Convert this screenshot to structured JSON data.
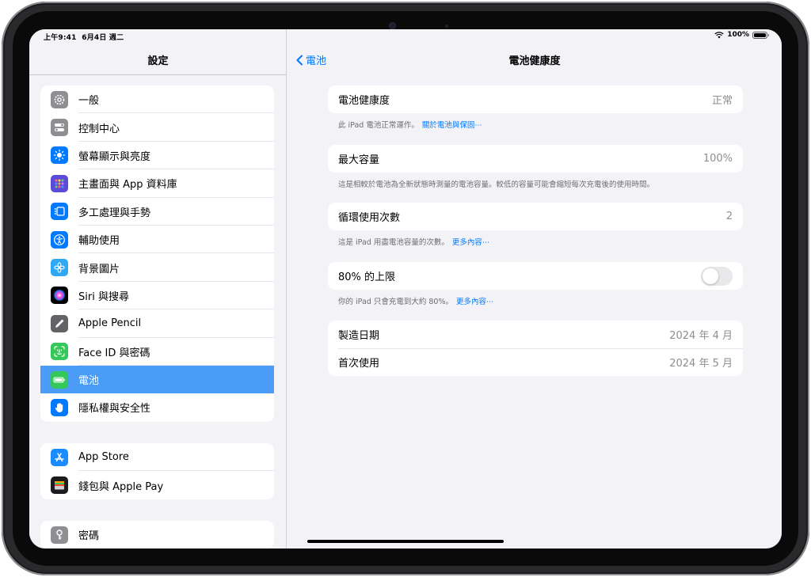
{
  "status_bar": {
    "time": "上午9:41",
    "date": "6月4日 週二",
    "battery": "100%"
  },
  "sidebar": {
    "title": "設定",
    "groups": [
      {
        "items": [
          {
            "label": "一般"
          },
          {
            "label": "控制中心"
          },
          {
            "label": "螢幕顯示與亮度"
          },
          {
            "label": "主畫面與 App 資料庫"
          },
          {
            "label": "多工處理與手勢"
          },
          {
            "label": "輔助使用"
          },
          {
            "label": "背景圖片"
          },
          {
            "label": "Siri 與搜尋"
          },
          {
            "label": "Apple Pencil"
          },
          {
            "label": "Face ID 與密碼"
          },
          {
            "label": "電池",
            "selected": true
          },
          {
            "label": "隱私權與安全性"
          }
        ]
      },
      {
        "items": [
          {
            "label": "App Store"
          },
          {
            "label": "錢包與 Apple Pay"
          }
        ]
      },
      {
        "items": [
          {
            "label": "密碼"
          }
        ]
      }
    ]
  },
  "detail": {
    "back_label": "電池",
    "title": "電池健康度",
    "battery_health": {
      "label": "電池健康度",
      "value": "正常",
      "note": "此 iPad 電池正常運作。",
      "link": "關於電池與保固⋯"
    },
    "max_capacity": {
      "label": "最大容量",
      "value": "100%",
      "note": "這是相較於電池為全新狀態時測量的電池容量。較低的容量可能會縮短每次充電後的使用時間。"
    },
    "cycle_count": {
      "label": "循環使用次數",
      "value": "2",
      "note": "這是 iPad 用盡電池容量的次數。",
      "link": "更多內容⋯"
    },
    "limit_80": {
      "label": "80% 的上限",
      "enabled": false,
      "note": "你的 iPad 只會充電到大約 80%。",
      "link": "更多內容⋯"
    },
    "dates": [
      {
        "label": "製造日期",
        "value": "2024 年 4 月"
      },
      {
        "label": "首次使用",
        "value": "2024 年 5 月"
      }
    ]
  },
  "colors": {
    "accent": "#007aff",
    "selected_row": "#4a9cf7"
  }
}
